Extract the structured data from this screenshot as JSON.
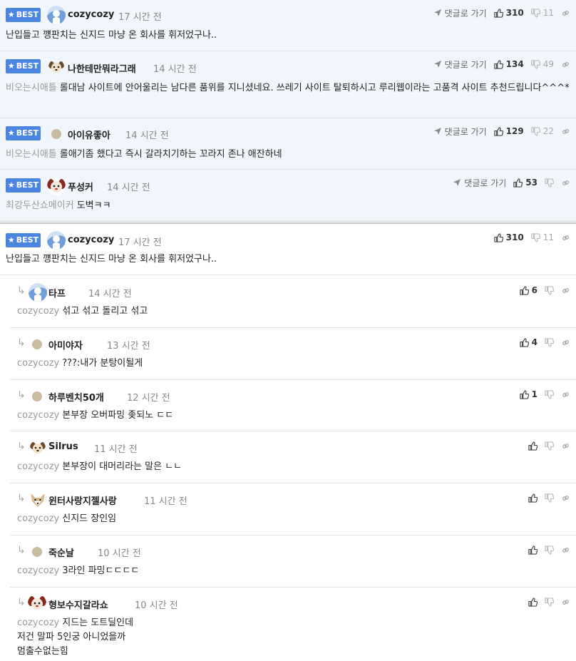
{
  "best_label": "BEST",
  "reply_label": "댓글로 가기",
  "best_comments": [
    {
      "nick": "cozycozy",
      "time": "17 시간 전",
      "mention": "",
      "text": "난입들고 꺵판치는 신지드 마냥 온 회사를 휘저었구나..",
      "likes": "310",
      "dislikes": "11",
      "avatar": "snow"
    },
    {
      "nick": "나한테만뭐라그래",
      "time": "14 시간 전",
      "mention": "비오는시애틀",
      "text": "롤대남 사이트에 안어울리는 남다른 품위를 지니셨네요. 쓰레기 사이트 탈퇴하시고 루리웹이라는 고품격 사이트 추천드립니다^^^*",
      "likes": "134",
      "dislikes": "49",
      "avatar": "dog"
    },
    {
      "nick": "아이유좋아",
      "time": "14 시간 전",
      "mention": "비오는시애틀",
      "text": "롤애기좀 했다고 즉시 갈라치기하는 꼬라지 존나 애잔하네",
      "likes": "129",
      "dislikes": "22",
      "avatar": "dot"
    },
    {
      "nick": "푸성커",
      "time": "14 시간 전",
      "mention": "최강두산쇼메이커",
      "text": "도벽ㅋㅋ",
      "likes": "53",
      "dislikes": "",
      "avatar": "redface"
    }
  ],
  "main_comment": {
    "nick": "cozycozy",
    "time": "17 시간 전",
    "text": "난입들고 꺵판치는 신지드 마냥 온 회사를 휘저었구나..",
    "likes": "310",
    "dislikes": "11"
  },
  "replies": [
    {
      "nick": "타프",
      "time": "14 시간 전",
      "mention": "cozycozy",
      "text": "섞고 섞고 돌리고 섞고",
      "likes": "6",
      "avatar": "snow"
    },
    {
      "nick": "아미야자",
      "time": "13 시간 전",
      "mention": "cozycozy",
      "text": "???:내가 분탕이될게",
      "likes": "4",
      "avatar": "dot"
    },
    {
      "nick": "하루벤치50개",
      "time": "12 시간 전",
      "mention": "cozycozy",
      "text": "본부장 오버파밍 좆되노 ㄷㄷ",
      "likes": "1",
      "avatar": "dot"
    },
    {
      "nick": "Silrus",
      "time": "11 시간 전",
      "mention": "cozycozy",
      "text": "본부장이 대머리라는 말은 ㄴㄴ",
      "likes": "",
      "avatar": "dog"
    },
    {
      "nick": "윈터사랑지젤사랑",
      "time": "11 시간 전",
      "mention": "cozycozy",
      "text": "신지드 장인임",
      "likes": "",
      "avatar": "fox"
    },
    {
      "nick": "죽순날",
      "time": "10 시간 전",
      "mention": "cozycozy",
      "text": "3라인 파밍ㄷㄷㄷㄷ",
      "likes": "",
      "avatar": "dot"
    },
    {
      "nick": "형보수지갈라쇼",
      "time": "10 시간 전",
      "mention": "cozycozy",
      "text": "지드는 도트딜인데",
      "text2": "저건 말파 5인궁 아니었을까",
      "text3": "멈출수없는힘",
      "likes": "",
      "avatar": "redface"
    }
  ]
}
